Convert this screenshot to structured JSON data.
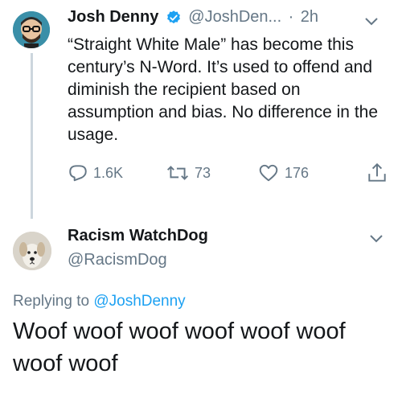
{
  "tweet": {
    "author_name": "Josh Denny",
    "author_handle": "@JoshDen...",
    "separator": "·",
    "time": "2h",
    "text": "“Straight White Male” has become this century’s N-Word. It’s used to offend and diminish the recipient based on assumption and bias. No difference in the usage.",
    "reply_count": "1.6K",
    "retweet_count": "73",
    "like_count": "176"
  },
  "reply": {
    "author_name": "Racism WatchDog",
    "author_handle": "@RacismDog",
    "replying_prefix": "Replying to",
    "replying_to": "@JoshDenny",
    "text": "Woof woof woof woof woof woof woof woof"
  },
  "colors": {
    "verified": "#1da1f2",
    "secondary_text": "#657786",
    "link": "#1da1f2"
  }
}
